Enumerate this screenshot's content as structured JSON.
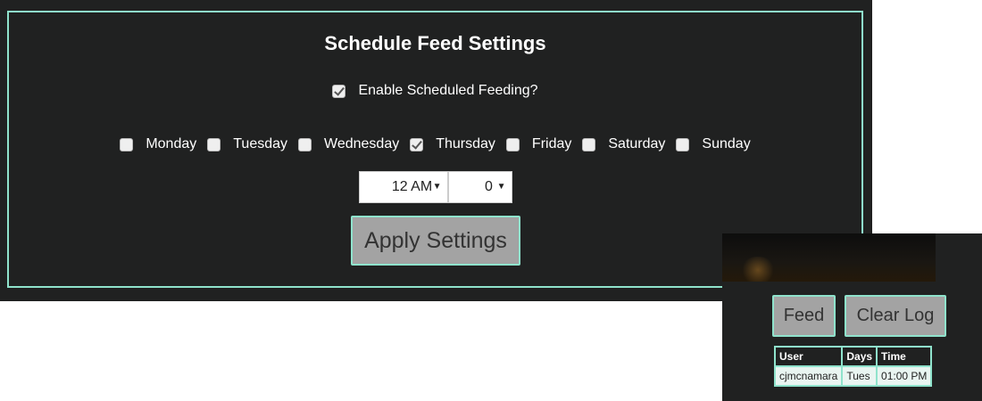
{
  "settings": {
    "title": "Schedule Feed Settings",
    "enable_label": "Enable Scheduled Feeding?",
    "enable_checked": true,
    "days": [
      {
        "label": "Monday",
        "checked": false
      },
      {
        "label": "Tuesday",
        "checked": false
      },
      {
        "label": "Wednesday",
        "checked": false
      },
      {
        "label": "Thursday",
        "checked": true
      },
      {
        "label": "Friday",
        "checked": false
      },
      {
        "label": "Saturday",
        "checked": false
      },
      {
        "label": "Sunday",
        "checked": false
      }
    ],
    "hour_select": "12 AM",
    "minute_select": "0",
    "apply_label": "Apply Settings"
  },
  "side": {
    "feed_label": "Feed",
    "clear_label": "Clear Log",
    "log": {
      "headers": [
        "User",
        "Days",
        "Time"
      ],
      "rows": [
        [
          "cjmcnamara",
          "Tues",
          "01:00 PM"
        ]
      ]
    }
  },
  "colors": {
    "panel_bg": "#202121",
    "accent_border": "#8fe3cc",
    "button_bg": "#a3a3a3"
  }
}
